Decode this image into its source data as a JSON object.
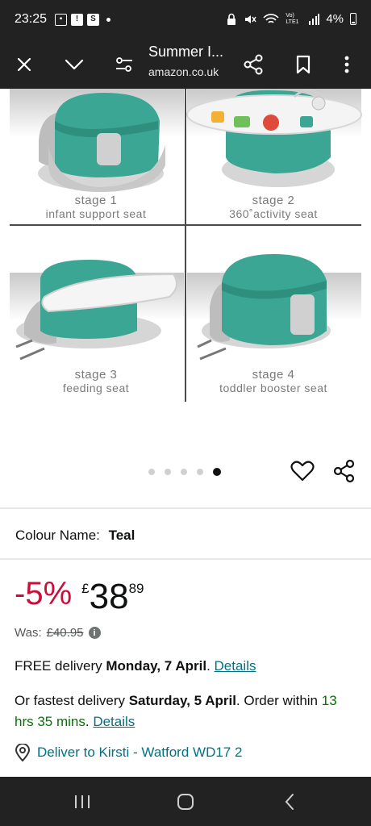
{
  "status_bar": {
    "time": "23:25",
    "battery": "4%",
    "signal_text": "Vo) LTE1"
  },
  "toolbar": {
    "title": "Summer I...",
    "domain": "amazon.co.uk"
  },
  "gallery": {
    "stages": [
      {
        "number": "stage 1",
        "description": "infant support seat"
      },
      {
        "number": "stage 2",
        "description": "360˚activity seat"
      },
      {
        "number": "stage 3",
        "description": "feeding seat"
      },
      {
        "number": "stage 4",
        "description": "toddler booster seat"
      }
    ],
    "page_count": 5,
    "active_page": 5
  },
  "product": {
    "colour_label": "Colour Name:",
    "colour_value": "Teal",
    "discount": "-5%",
    "currency": "£",
    "price_whole": "38",
    "price_fraction": "89",
    "was_label": "Was:",
    "was_price": "£40.95"
  },
  "delivery": {
    "free_prefix": "FREE delivery ",
    "free_date": "Monday, 7 April",
    "free_suffix": ". ",
    "details_label": "Details",
    "fast_prefix": "Or fastest delivery ",
    "fast_date": "Saturday, 5 April",
    "fast_mid": ". Order within ",
    "fast_time": "13 hrs 35 mins",
    "fast_suffix": ". ",
    "deliver_to": "Deliver to Kirsti - Watford WD17 2"
  },
  "colors": {
    "bar_bg": "#222222",
    "discount_red": "#cc0c39",
    "link_teal": "#007185",
    "seat_teal": "#3aa693"
  }
}
